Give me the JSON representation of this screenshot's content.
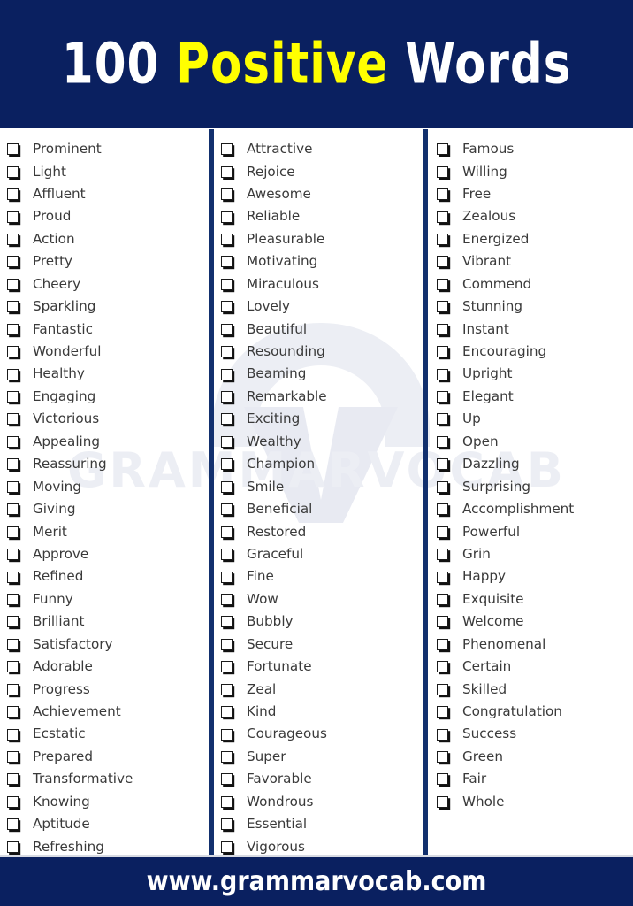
{
  "header": {
    "title_part1": "100",
    "title_part2": "Positive",
    "title_part3": "Words",
    "background_color": "#0a2060",
    "highlight_color": "#ffff00",
    "text_color": "#ffffff"
  },
  "watermark": {
    "text": "GRAMMARVOCAB",
    "color": "#eceef4"
  },
  "list": {
    "checkbox_icon": "checkbox-empty-icon",
    "columns": [
      {
        "id": "column-1",
        "words": [
          "Prominent",
          "Light",
          "Affluent",
          "Proud",
          "Action",
          "Pretty",
          "Cheery",
          "Sparkling",
          "Fantastic",
          "Wonderful",
          "Healthy",
          "Engaging",
          "Victorious",
          "Appealing",
          "Reassuring",
          "Moving",
          "Giving",
          "Merit",
          "Approve",
          "Refined",
          "Funny",
          "Brilliant",
          "Satisfactory",
          "Adorable",
          "Progress",
          "Achievement",
          "Ecstatic",
          "Prepared",
          "Transformative",
          "Knowing",
          "Aptitude",
          "Refreshing"
        ]
      },
      {
        "id": "column-2",
        "words": [
          "Attractive",
          "Rejoice",
          "Awesome",
          "Reliable",
          "Pleasurable",
          "Motivating",
          "Miraculous",
          "Lovely",
          "Beautiful",
          "Resounding",
          "Beaming",
          "Remarkable",
          "Exciting",
          "Wealthy",
          "Champion",
          "Smile",
          "Beneficial",
          "Restored",
          "Graceful",
          "Fine",
          "Wow",
          "Bubbly",
          "Secure",
          "Fortunate",
          "Zeal",
          "Kind",
          "Courageous",
          "Super",
          "Favorable",
          "Wondrous",
          "Essential",
          "Vigorous"
        ]
      },
      {
        "id": "column-3",
        "words": [
          "Famous",
          "Willing",
          "Free",
          "Zealous",
          "Energized",
          "Vibrant",
          "Commend",
          "Stunning",
          "Instant",
          "Encouraging",
          "Upright",
          "Elegant",
          "Up",
          "Open",
          "Dazzling",
          "Surprising",
          "Accomplishment",
          "Powerful",
          "Grin",
          "Happy",
          "Exquisite",
          "Welcome",
          "Phenomenal",
          "Certain",
          "Skilled",
          "Congratulation",
          "Success",
          "Green",
          "Fair",
          "Whole"
        ]
      }
    ]
  },
  "footer": {
    "website": "www.grammarvocab.com",
    "background_color": "#0a2060"
  }
}
